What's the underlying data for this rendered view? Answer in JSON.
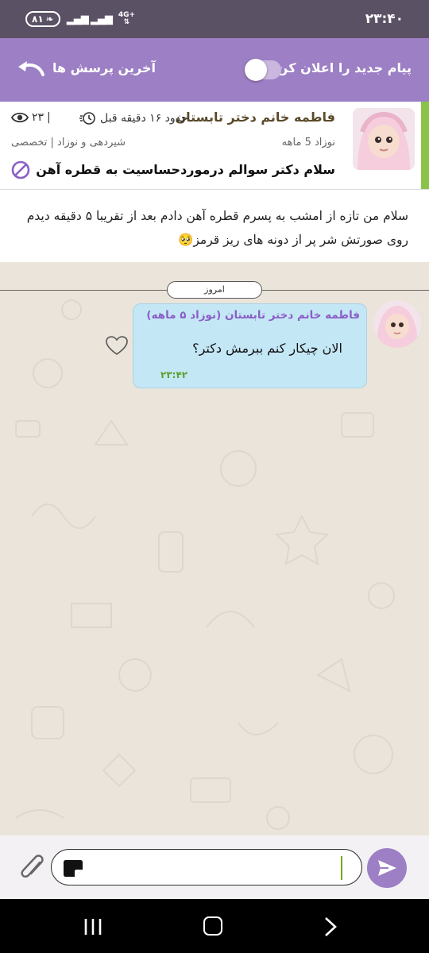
{
  "status_bar": {
    "time": "۲۳:۴۰",
    "battery": "۸۱",
    "network": "4G+"
  },
  "toolbar": {
    "notify_label": "پیام جدید را اعلان کن",
    "notify_enabled": false,
    "recent_questions_label": "آخرین پرسش ها",
    "back_icon": "back-arrow-icon"
  },
  "question": {
    "author": "فاطمه خانم دختر تابستان",
    "time_ago": "حدود ۱۶ دقیقه قبل",
    "views": "۲۳",
    "child_age": "نوزاد 5 ماهه",
    "category": "شیردهی و نوزاد | تخصصی",
    "title": "سلام دکتر سوالم درموردحساسیت به قطره آهن",
    "description": "سلام من تازه از امشب به پسرم قطره آهن دادم بعد از تقریبا ۵ دقیقه دیدم روی صورتش شر پر از دونه های ریز قرمز🥺",
    "accent_color": "#8bc34a"
  },
  "chat": {
    "date_label": "امروز",
    "messages": [
      {
        "author": "فاطمه خانم دختر تابستان (نوزاد ۵ ماهه)",
        "text": "الان چیکار کنم ببرمش دکتر؟",
        "time": "۲۳:۴۲",
        "liked": false
      }
    ]
  },
  "composer": {
    "placeholder": ""
  },
  "colors": {
    "brand": "#9c7fc4",
    "status_bar": "#5b5165",
    "bubble": "#c4e7f6",
    "author_purple": "#8a5fc7",
    "time_green": "#5aa02c"
  }
}
